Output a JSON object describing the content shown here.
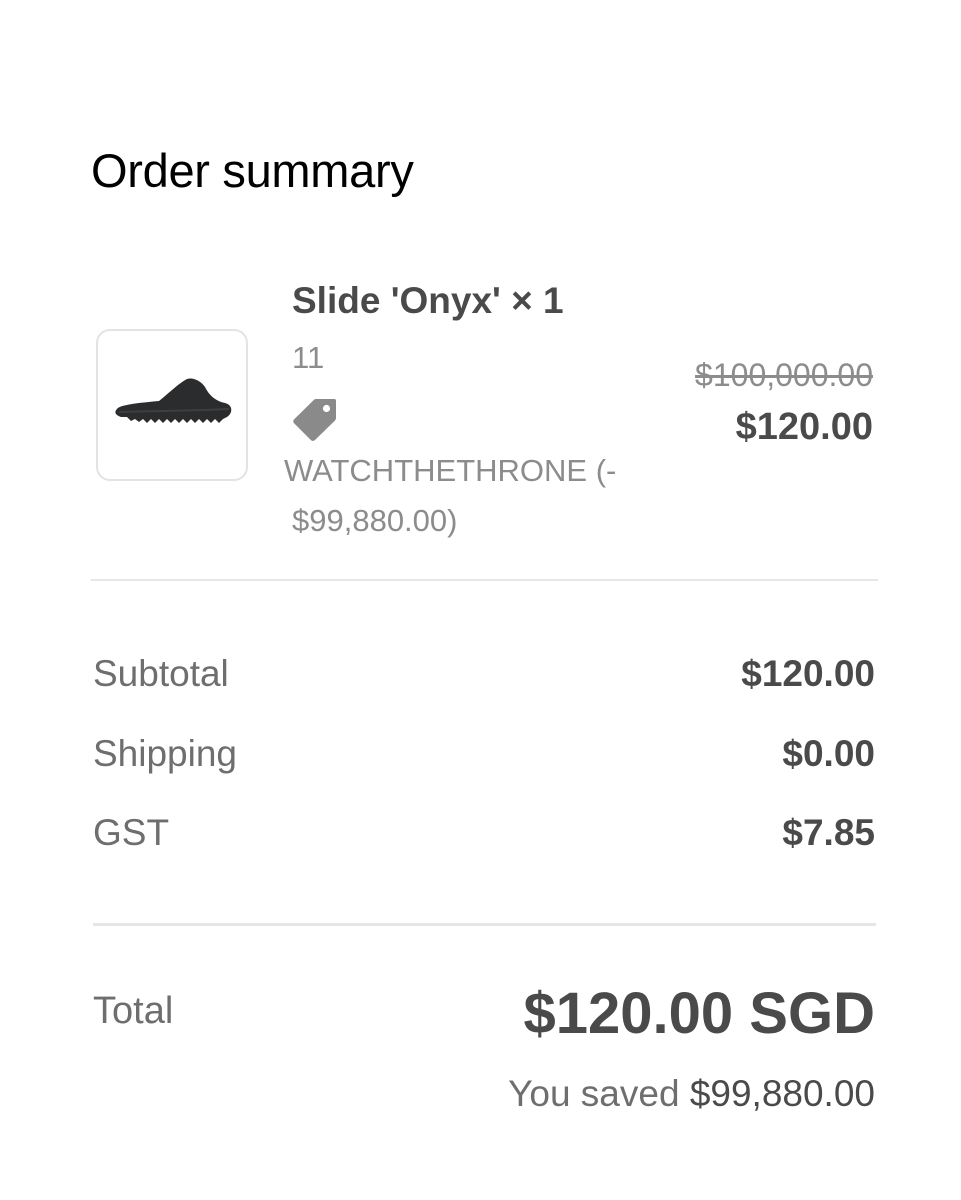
{
  "page": {
    "title": "Order summary"
  },
  "product": {
    "name": "Slide 'Onyx' × 1",
    "variant": "11",
    "image_icon": "slide-sandal-icon",
    "discount_icon": "price-tag-icon",
    "discount_line1": "WATCHTHETHRONE (-",
    "discount_line2": "$99,880.00)",
    "original_price": "$100,000.00",
    "final_price": "$120.00"
  },
  "summary": {
    "rows": [
      {
        "label": "Subtotal",
        "value": "$120.00"
      },
      {
        "label": "Shipping",
        "value": "$0.00"
      },
      {
        "label": "GST",
        "value": "$7.85"
      }
    ]
  },
  "total": {
    "label": "Total",
    "value": "$120.00 SGD",
    "saved_prefix": "You saved",
    "saved_amount": "$99,880.00"
  },
  "colors": {
    "heading": "#000000",
    "primary_text": "#4a4a4a",
    "secondary_text": "#8c8c8c",
    "divider": "#e6e6e6",
    "thumb_border": "#e3e3e3"
  }
}
